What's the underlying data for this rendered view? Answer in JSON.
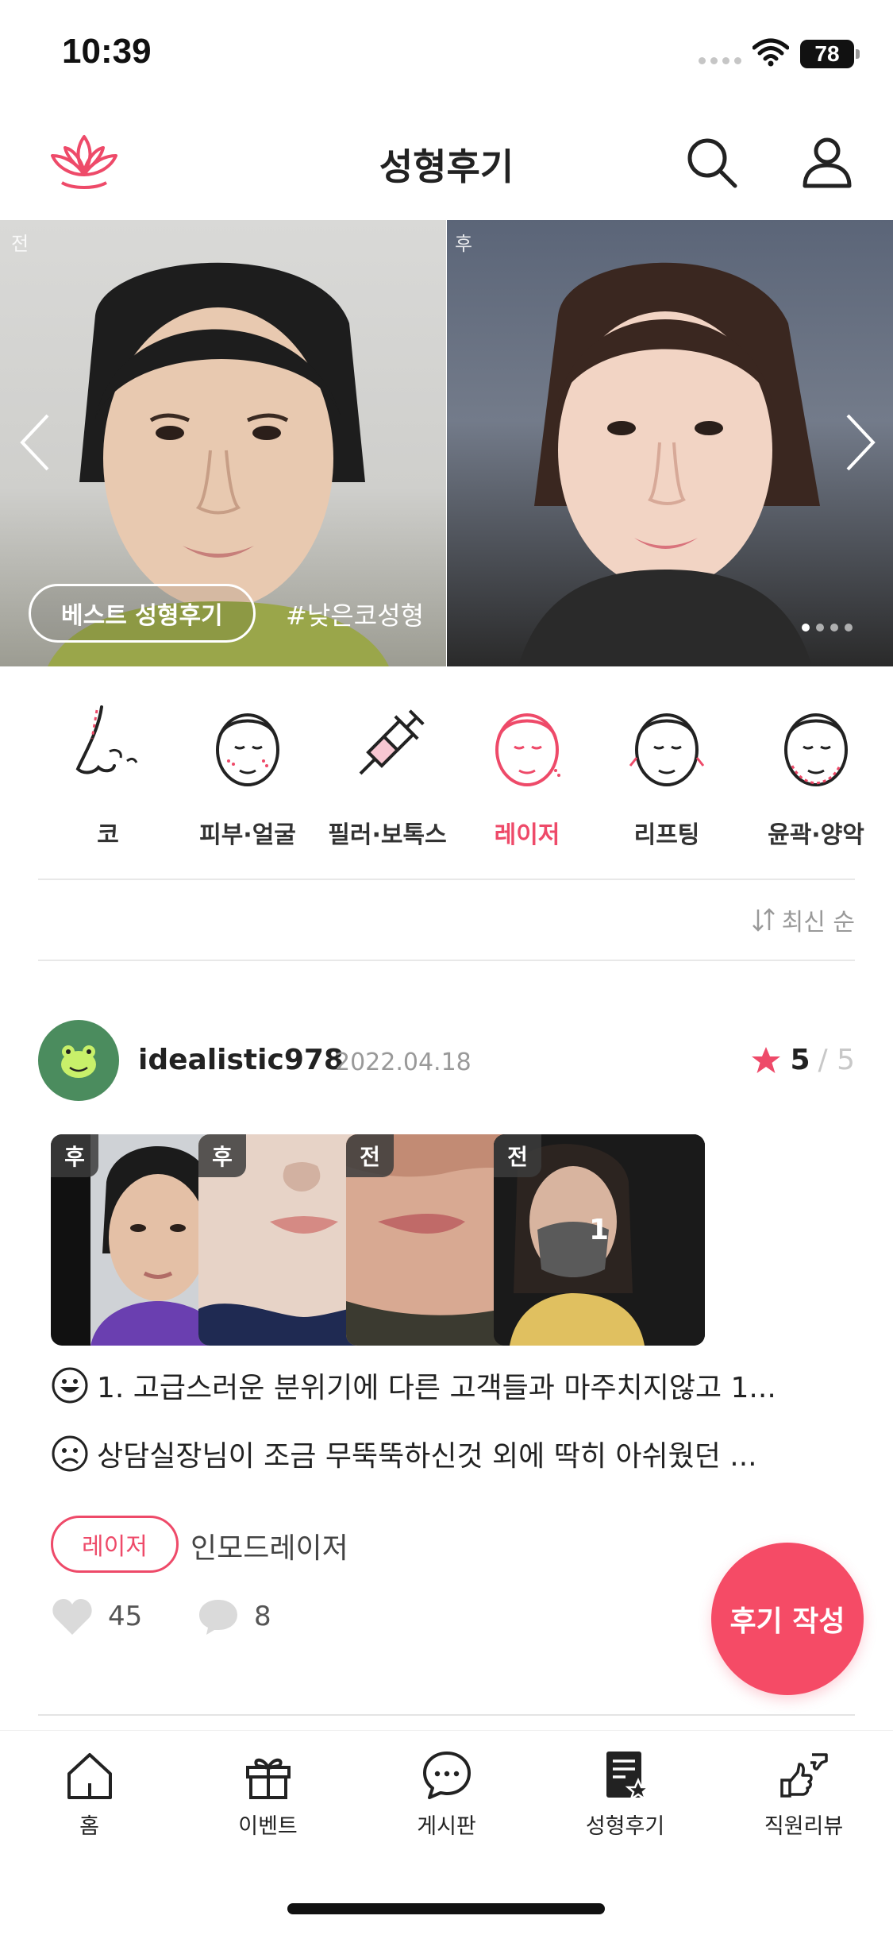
{
  "status_bar": {
    "time": "10:39",
    "battery": "78"
  },
  "header": {
    "title": "성형후기"
  },
  "banner": {
    "before_tag": "전",
    "after_tag": "후",
    "badge": "베스트 성형후기",
    "hashtag": "#낮은코성형"
  },
  "categories": [
    {
      "label": "코",
      "icon": "nose-icon"
    },
    {
      "label": "피부·얼굴",
      "icon": "face-skin-icon"
    },
    {
      "label": "필러·보톡스",
      "icon": "syringe-icon"
    },
    {
      "label": "레이저",
      "icon": "laser-face-icon",
      "active": true
    },
    {
      "label": "리프팅",
      "icon": "lifting-face-icon"
    },
    {
      "label": "윤곽·양악",
      "icon": "contour-face-icon"
    }
  ],
  "sort": {
    "label": "최신 순"
  },
  "review": {
    "username": "idealistic978",
    "date": "2022.04.18",
    "rating": "5",
    "rating_max": "/ 5",
    "photos": [
      {
        "tag": "후"
      },
      {
        "tag": "후"
      },
      {
        "tag": "전"
      },
      {
        "tag": "전",
        "count": "1"
      }
    ],
    "good_text": "1. 고급스러운 분위기에 다른 고객들과 마주치지않고 1...",
    "bad_text": "상담실장님이 조금 무뚝뚝하신것 외에 딱히 아쉬웠던 ...",
    "tag": "레이저",
    "treatment": "인모드레이저",
    "likes": "45",
    "comments": "8"
  },
  "fab": {
    "label": "후기 작성"
  },
  "bottom_nav": [
    {
      "label": "홈",
      "icon": "home-icon"
    },
    {
      "label": "이벤트",
      "icon": "gift-icon"
    },
    {
      "label": "게시판",
      "icon": "chat-bubble-icon"
    },
    {
      "label": "성형후기",
      "icon": "review-document-icon",
      "active": true
    },
    {
      "label": "직원리뷰",
      "icon": "thumbs-icon"
    }
  ],
  "colors": {
    "accent": "#ee4a69",
    "fab": "#f54b66"
  }
}
